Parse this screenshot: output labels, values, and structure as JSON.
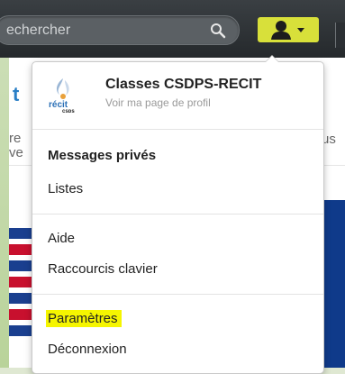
{
  "search": {
    "placeholder": "echercher"
  },
  "profile": {
    "name": "Classes CSDPS-RECIT",
    "subtitle": "Voir ma page de profil",
    "logo_text": "récit csps"
  },
  "background": {
    "t_char": "t",
    "re_text": "re\nve",
    "us_text": "us"
  },
  "menu": {
    "messages": "Messages privés",
    "lists": "Listes",
    "help": "Aide",
    "shortcuts": "Raccourcis clavier",
    "settings": "Paramètres",
    "logout": "Déconnexion"
  },
  "colors": {
    "accent_user_button": "#d8e03a",
    "highlight": "#f5f500",
    "navbar": "#2b2f33"
  },
  "icons": {
    "search": "search-icon",
    "user": "user-icon",
    "caret": "chevron-down-icon"
  }
}
